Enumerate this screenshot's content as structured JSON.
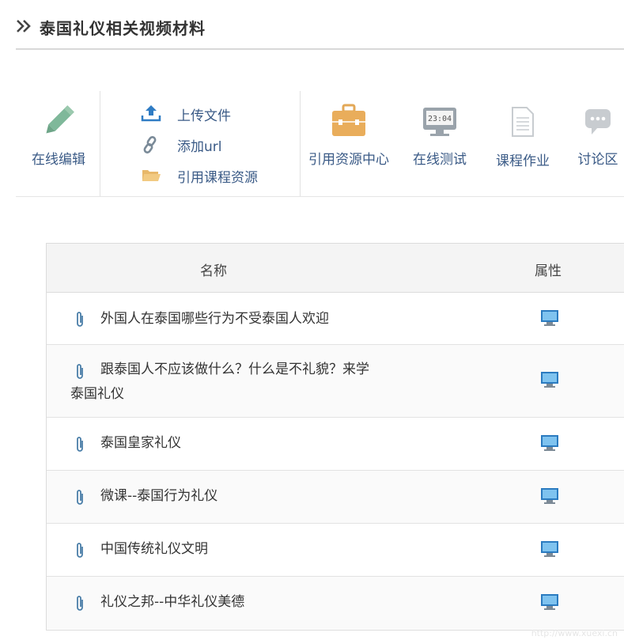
{
  "page": {
    "title": "泰国礼仪相关视频材料"
  },
  "toolbar": {
    "online_edit": "在线编辑",
    "upload": "上传文件",
    "add_url": "添加url",
    "cite_course": "引用课程资源",
    "resource_center": "引用资源中心",
    "online_test": "在线测试",
    "homework": "课程作业",
    "discussion": "讨论区",
    "clock_text": "23:04"
  },
  "table": {
    "headers": {
      "name": "名称",
      "attr": "属性"
    },
    "rows": [
      {
        "name": "外国人在泰国哪些行为不受泰国人欢迎"
      },
      {
        "name": "跟泰国人不应该做什么？什么是不礼貌？来学泰国礼仪"
      },
      {
        "name": "泰国皇家礼仪"
      },
      {
        "name": "微课--泰国行为礼仪"
      },
      {
        "name": "中国传统礼仪文明"
      },
      {
        "name": "礼仪之邦--中华礼仪美德"
      }
    ]
  },
  "watermark": "http://www.xuexi.cn",
  "colors": {
    "link": "#3a5a86",
    "pencil": "#7fb89a",
    "folder": "#e8b86a",
    "monitor": "#3d8fcf"
  }
}
